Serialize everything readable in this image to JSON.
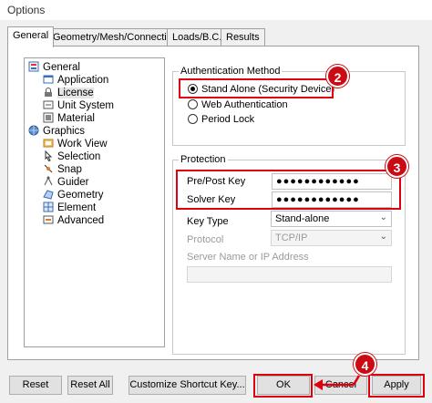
{
  "window": {
    "title": "Options"
  },
  "tabs": [
    "General",
    "Geometry/Mesh/Connections",
    "Loads/B.C.",
    "Results"
  ],
  "tree": {
    "general": {
      "label": "General",
      "icon": "general-settings-icon"
    },
    "general_children": [
      {
        "label": "Application",
        "icon": "application-icon"
      },
      {
        "label": "License",
        "icon": "lock-icon"
      },
      {
        "label": "Unit System",
        "icon": "unit-system-icon"
      },
      {
        "label": "Material",
        "icon": "material-icon"
      }
    ],
    "graphics": {
      "label": "Graphics",
      "icon": "globe-icon"
    },
    "graphics_children": [
      {
        "label": "Work View",
        "icon": "work-view-icon"
      },
      {
        "label": "Selection",
        "icon": "selection-icon"
      },
      {
        "label": "Snap",
        "icon": "snap-icon"
      },
      {
        "label": "Guider",
        "icon": "guider-icon"
      },
      {
        "label": "Geometry",
        "icon": "geometry-icon"
      },
      {
        "label": "Element",
        "icon": "element-icon"
      },
      {
        "label": "Advanced",
        "icon": "advanced-icon"
      }
    ]
  },
  "auth": {
    "legend": "Authentication Method",
    "options": [
      "Stand Alone (Security Device)",
      "Web Authentication",
      "Period Lock"
    ],
    "selected": "Stand Alone (Security Device)"
  },
  "protection": {
    "legend": "Protection",
    "prepost_label": "Pre/Post Key",
    "prepost_value": "●●●●●●●●●●●●",
    "solver_label": "Solver Key",
    "solver_value": "●●●●●●●●●●●●",
    "keytype_label": "Key Type",
    "keytype_value": "Stand-alone",
    "protocol_label": "Protocol",
    "protocol_value": "TCP/IP",
    "server_label": "Server Name or IP Address",
    "server_value": ""
  },
  "buttons": {
    "reset": "Reset",
    "reset_all": "Reset All",
    "shortcut": "Customize Shortcut Key...",
    "ok": "OK",
    "cancel": "Cancel",
    "apply": "Apply"
  },
  "callouts": [
    "2",
    "3",
    "4"
  ],
  "colors": {
    "highlight": "#e0000d",
    "callout": "#cc0a14"
  }
}
